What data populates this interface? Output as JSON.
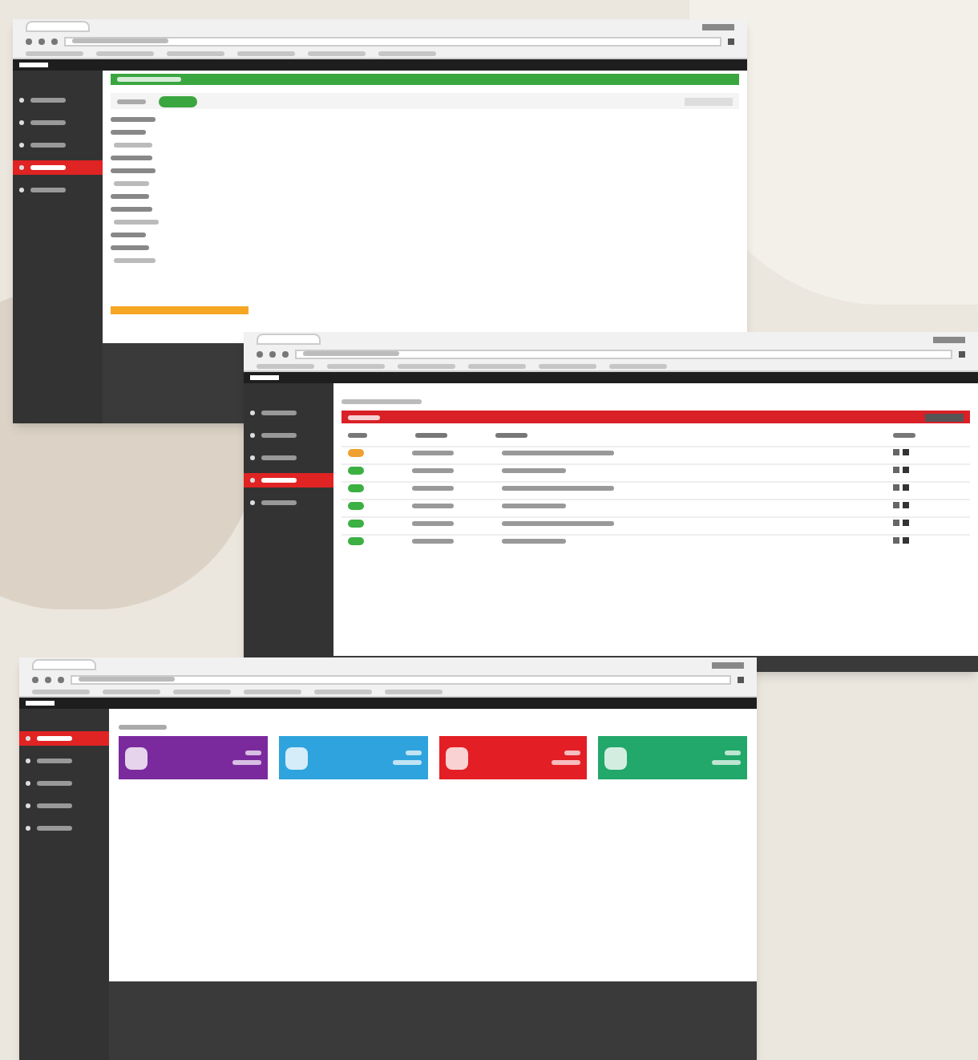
{
  "windows": [
    {
      "kind": "form",
      "sidebar": [
        {
          "selected": false
        },
        {
          "selected": false
        },
        {
          "selected": false
        },
        {
          "selected": true
        },
        {
          "selected": false
        }
      ]
    },
    {
      "kind": "table",
      "sidebar": [
        {
          "selected": false
        },
        {
          "selected": false
        },
        {
          "selected": false
        },
        {
          "selected": true
        },
        {
          "selected": false
        }
      ],
      "rows": [
        {
          "color": "#f0a030"
        },
        {
          "color": "#3cb043"
        },
        {
          "color": "#3cb043"
        },
        {
          "color": "#3cb043"
        },
        {
          "color": "#3cb043"
        },
        {
          "color": "#3cb043"
        }
      ]
    },
    {
      "kind": "dashboard",
      "sidebar": [
        {
          "selected": true
        },
        {
          "selected": false
        },
        {
          "selected": false
        },
        {
          "selected": false
        },
        {
          "selected": false
        }
      ],
      "tiles": [
        {
          "color": "#7b2a9e"
        },
        {
          "color": "#2ea3dd"
        },
        {
          "color": "#e31e24"
        },
        {
          "color": "#22a86a"
        }
      ]
    }
  ]
}
